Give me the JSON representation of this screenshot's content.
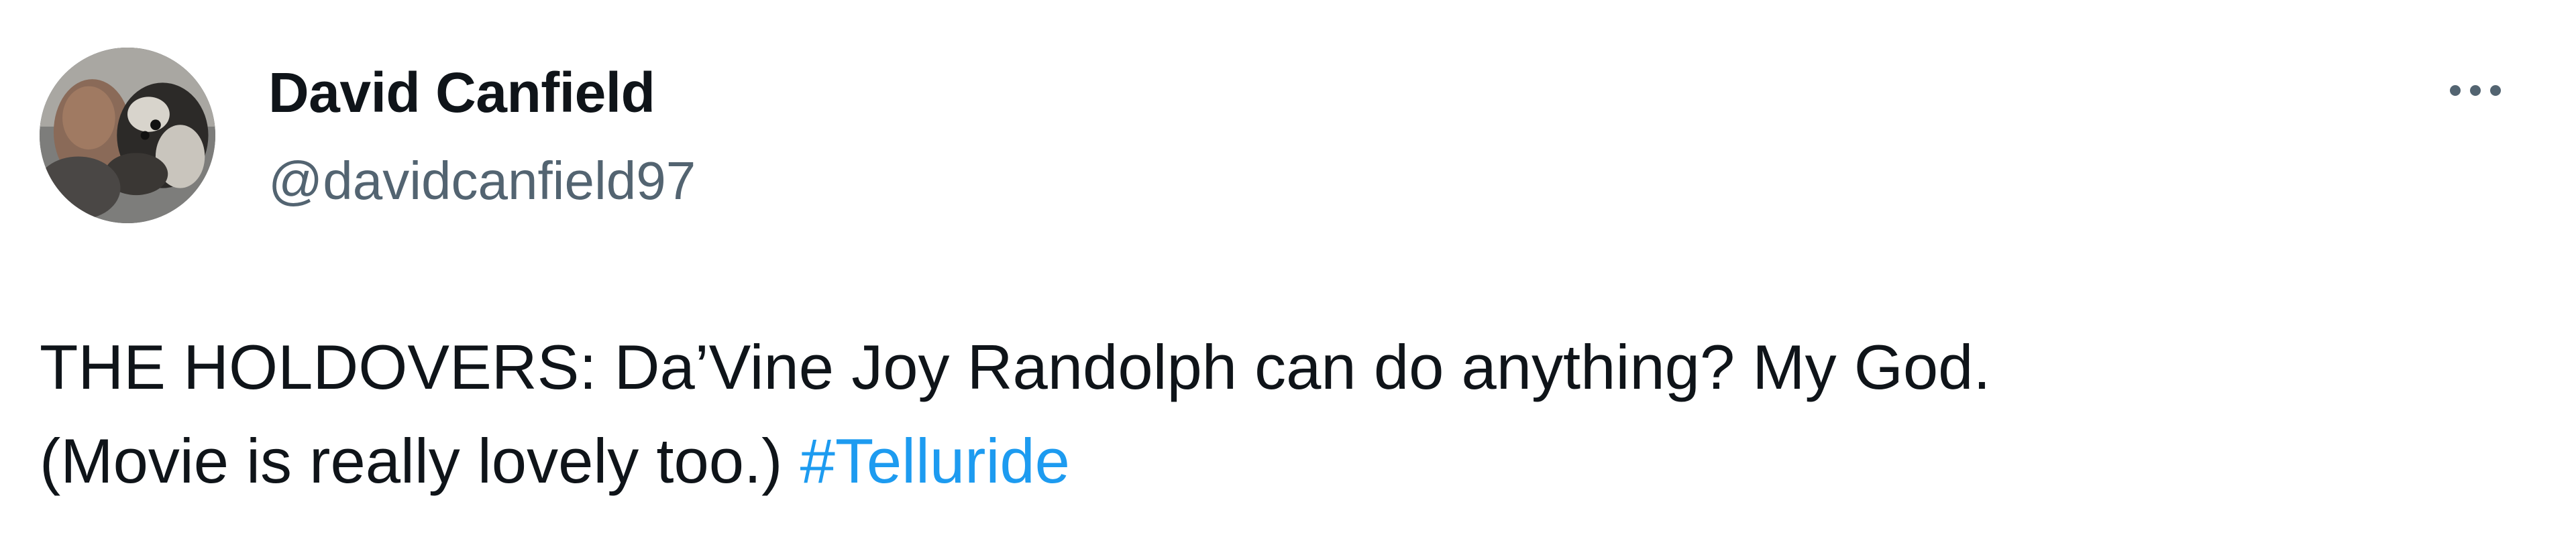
{
  "tweet": {
    "author": {
      "display_name": "David Canfield",
      "handle": "@davidcanfield97",
      "avatar_icon": "avatar-photo"
    },
    "more_icon": "more-horizontal-icon",
    "text_line_1": "THE HOLDOVERS: Da’Vine Joy Randolph can do anything? My God.",
    "text_line_2": "(Movie is really lovely too.)",
    "hashtag": "#Telluride"
  },
  "colors": {
    "text": "#0f1419",
    "secondary_text": "#536471",
    "link": "#1d9bf0",
    "background": "#ffffff"
  }
}
